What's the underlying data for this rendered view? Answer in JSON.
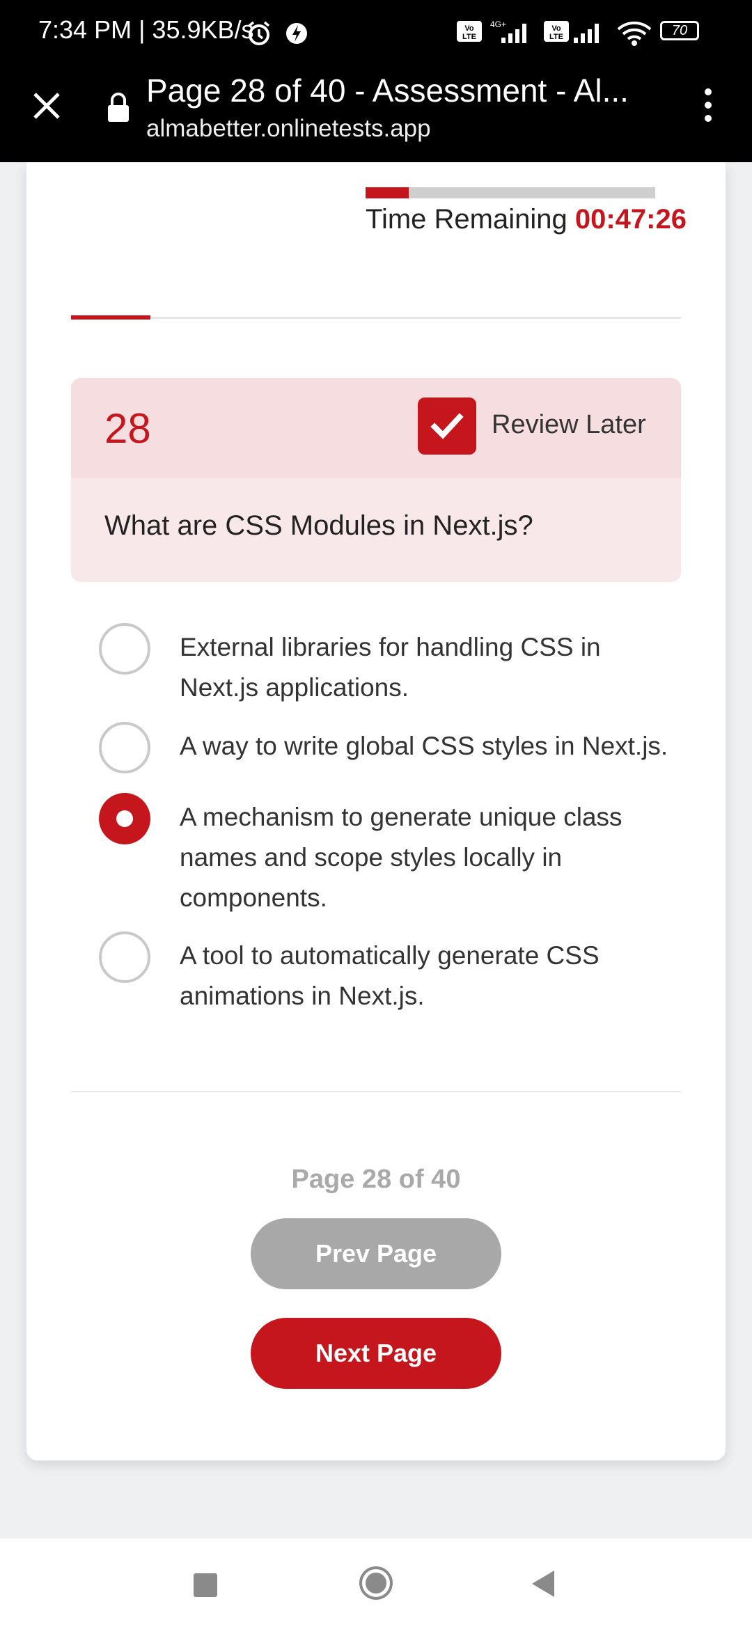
{
  "status_bar": {
    "time_speed": "7:34 PM | 35.9KB/s",
    "battery": "70"
  },
  "browser": {
    "title": "Page 28 of 40 - Assessment - Al...",
    "url": "almabetter.onlinetests.app"
  },
  "timer": {
    "label": "Time Remaining",
    "value": "00:47:26",
    "progress_fraction": 0.15
  },
  "progress": {
    "fraction": 0.13
  },
  "question": {
    "number": "28",
    "review_label": "Review Later",
    "review_checked": true,
    "text": "What are CSS Modules in Next.js?",
    "options": [
      {
        "text": "External libraries for handling CSS in Next.js applications.",
        "selected": false
      },
      {
        "text": "A way to write global CSS styles in Next.js.",
        "selected": false
      },
      {
        "text": "A mechanism to generate unique class names and scope styles locally in components.",
        "selected": true
      },
      {
        "text": "A tool to automatically generate CSS animations in Next.js.",
        "selected": false
      }
    ]
  },
  "pagination": {
    "indicator": "Page 28 of 40",
    "prev_label": "Prev Page",
    "next_label": "Next Page"
  },
  "colors": {
    "accent": "#c4161c",
    "disabled": "#a8a8a8"
  }
}
